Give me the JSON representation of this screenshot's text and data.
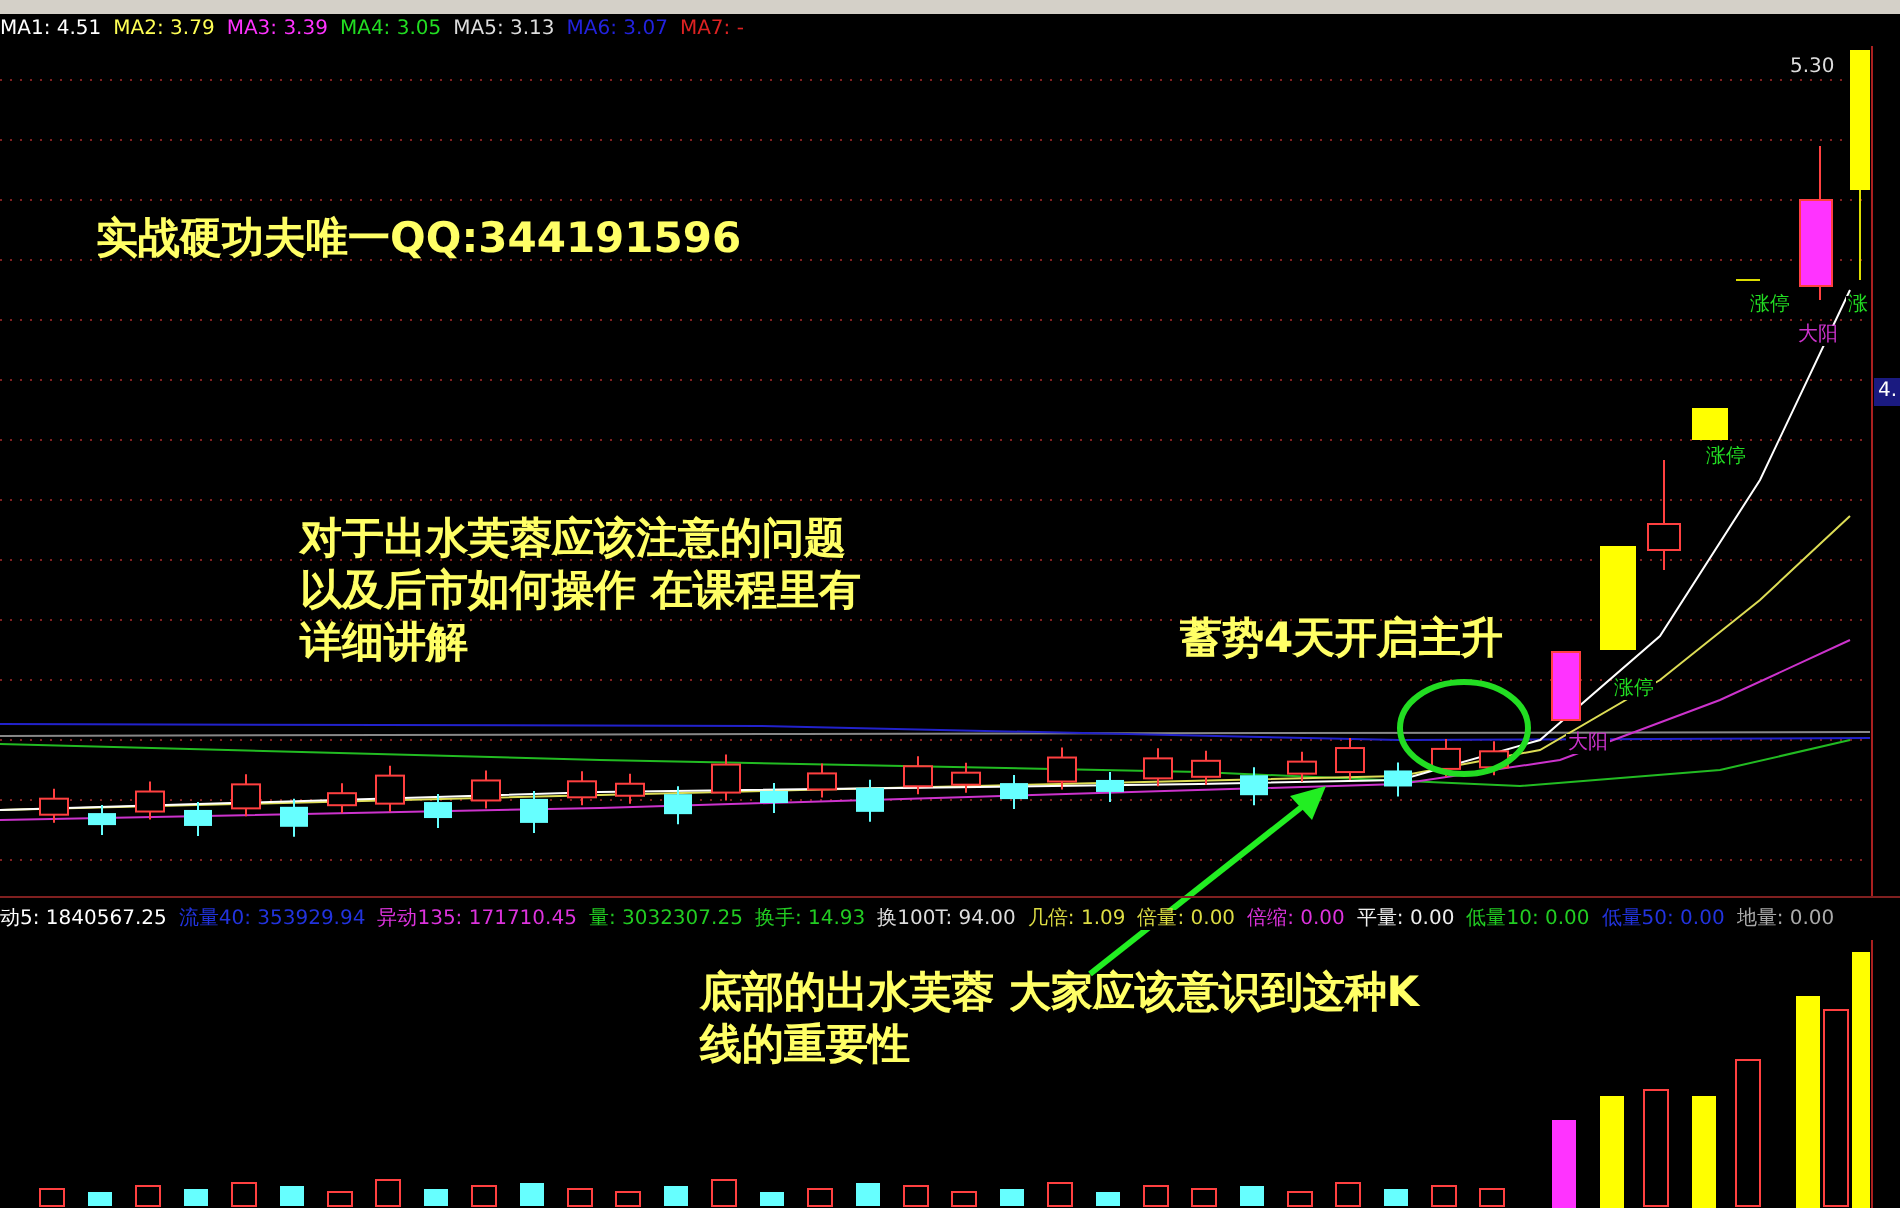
{
  "ma_legend": [
    {
      "label": "MA1: 4.51",
      "color": "#ffffff"
    },
    {
      "label": "MA2: 3.79",
      "color": "#ffff55"
    },
    {
      "label": "MA3: 3.39",
      "color": "#ff33ff"
    },
    {
      "label": "MA4: 3.05",
      "color": "#22dd22"
    },
    {
      "label": "MA5: 3.13",
      "color": "#dddddd"
    },
    {
      "label": "MA6: 3.07",
      "color": "#2222dd"
    },
    {
      "label": "MA7: -",
      "color": "#dd2222"
    }
  ],
  "price_axis": {
    "top_label": "5.30",
    "current_badge": "4."
  },
  "annotations": [
    {
      "lines": [
        "实战硬功夫唯一QQ:344191596"
      ]
    },
    {
      "lines": [
        "对于出水芙蓉应该注意的问题",
        "以及后市如何操作 在课程里有",
        "详细讲解"
      ]
    },
    {
      "lines": [
        "蓄势4天开启主升"
      ]
    },
    {
      "lines": [
        "底部的出水芙蓉 大家应该意识到这种K",
        "线的重要性"
      ]
    }
  ],
  "chart_markers": [
    {
      "text": "涨停",
      "kind": "limit_up"
    },
    {
      "text": "涨",
      "kind": "limit_up"
    },
    {
      "text": "大阳",
      "kind": "big_yang"
    },
    {
      "text": "涨停",
      "kind": "limit_up"
    },
    {
      "text": "涨停",
      "kind": "limit_up"
    },
    {
      "text": "大阳",
      "kind": "big_yang"
    }
  ],
  "volume_legend": [
    {
      "label": "动5: 1840567.25",
      "color": "#ffffff"
    },
    {
      "label": "流量40: 353929.94",
      "color": "#2233dd"
    },
    {
      "label": "异动135: 171710.45",
      "color": "#dd33dd"
    },
    {
      "label": "量: 3032307.25",
      "color": "#22cc22"
    },
    {
      "label": "换手: 14.93",
      "color": "#22cc22"
    },
    {
      "label": "换100T: 94.00",
      "color": "#dddddd"
    },
    {
      "label": "几倍: 1.09",
      "color": "#dddd44"
    },
    {
      "label": "倍量: 0.00",
      "color": "#dddd44"
    },
    {
      "label": "倍缩: 0.00",
      "color": "#dd33dd"
    },
    {
      "label": "平量: 0.00",
      "color": "#eeeeee"
    },
    {
      "label": "低量10: 0.00",
      "color": "#22cc22"
    },
    {
      "label": "低量50: 0.00",
      "color": "#2233dd"
    },
    {
      "label": "地量: 0.00",
      "color": "#aaaaaa"
    }
  ]
}
